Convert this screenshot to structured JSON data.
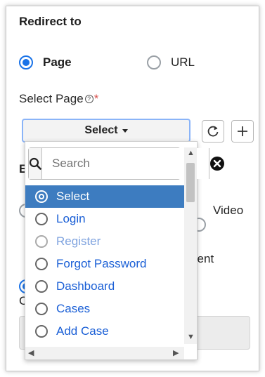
{
  "heading": "Redirect to",
  "redirect_options": [
    {
      "label": "Page",
      "checked": true
    },
    {
      "label": "URL",
      "checked": false
    }
  ],
  "select_page": {
    "label": "Select Page",
    "help_icon": "?",
    "required_mark": "*",
    "button_label": "Select"
  },
  "underlay": {
    "partial_letter_e": "E",
    "video_label": "Video",
    "client_label": "lient",
    "partial_letter_c": "C"
  },
  "dropdown": {
    "search_placeholder": "Search",
    "items": [
      {
        "label": "Select",
        "selected": true,
        "disabled": false
      },
      {
        "label": "Login",
        "selected": false,
        "disabled": false
      },
      {
        "label": "Register",
        "selected": false,
        "disabled": true
      },
      {
        "label": "Forgot Password",
        "selected": false,
        "disabled": false
      },
      {
        "label": "Dashboard",
        "selected": false,
        "disabled": false
      },
      {
        "label": "Cases",
        "selected": false,
        "disabled": false
      },
      {
        "label": "Add Case",
        "selected": false,
        "disabled": false
      }
    ]
  },
  "icons": {
    "refresh": "refresh-icon",
    "add": "plus-icon",
    "search": "search-icon",
    "clear": "clear-x-icon"
  },
  "colors": {
    "accent": "#1a73e8",
    "selected_bg": "#3d7cc0",
    "link": "#1a5fd6",
    "required": "#d9534f"
  }
}
